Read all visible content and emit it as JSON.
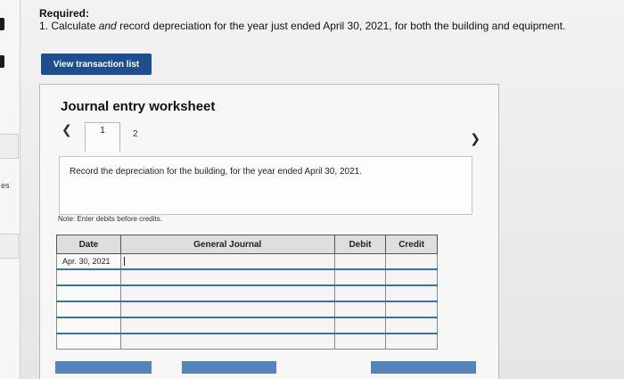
{
  "required": {
    "title": "Required:",
    "line_prefix": "1. Calculate ",
    "line_italic": "and",
    "line_suffix": " record depreciation for the year just ended April 30, 2021, for both the building and equipment."
  },
  "view_transaction_label": "View transaction list",
  "left_strip_text": "es",
  "worksheet": {
    "title": "Journal entry worksheet",
    "tabs": [
      "1",
      "2"
    ],
    "active_tab": "1",
    "instruction": "Record the depreciation for the building, for the year ended April 30, 2021.",
    "note": "Note: Enter debits before credits."
  },
  "journal": {
    "headers": {
      "date": "Date",
      "general_journal": "General Journal",
      "debit": "Debit",
      "credit": "Credit"
    },
    "rows": [
      {
        "date": "Apr. 30, 2021",
        "account": "",
        "debit": "",
        "credit": ""
      },
      {
        "date": "",
        "account": "",
        "debit": "",
        "credit": ""
      },
      {
        "date": "",
        "account": "",
        "debit": "",
        "credit": ""
      },
      {
        "date": "",
        "account": "",
        "debit": "",
        "credit": ""
      },
      {
        "date": "",
        "account": "",
        "debit": "",
        "credit": ""
      },
      {
        "date": "",
        "account": "",
        "debit": "",
        "credit": ""
      }
    ]
  },
  "colors": {
    "primary_button": "#1f4e8c",
    "row_separator": "#3d6fb0"
  }
}
